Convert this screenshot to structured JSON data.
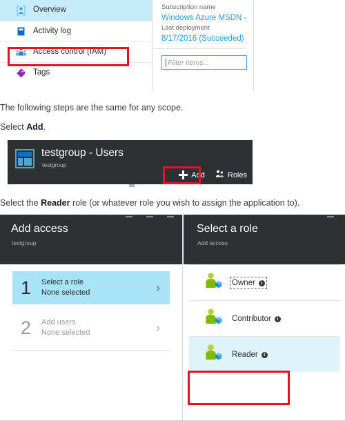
{
  "resource_nav": {
    "items": [
      {
        "label": "Overview",
        "icon": "overview-icon",
        "selected": true
      },
      {
        "label": "Activity log",
        "icon": "activity-log-icon",
        "selected": false
      },
      {
        "label": "Access control (IAM)",
        "icon": "access-control-icon",
        "selected": false
      },
      {
        "label": "Tags",
        "icon": "tag-icon",
        "selected": false
      }
    ]
  },
  "properties": {
    "subscription_label": "Subscription name",
    "subscription_value": "Windows Azure MSDN -",
    "deployment_label": "Last deployment",
    "deployment_value": "8/17/2016 (Succeeded)",
    "filter_placeholder": "Filter items..."
  },
  "prose": {
    "line1": "The following steps are the same for any scope.",
    "line2_prefix": "Select ",
    "line2_bold": "Add",
    "line2_suffix": ".",
    "line3_prefix": "Select the ",
    "line3_bold": "Reader",
    "line3_suffix": " role (or whatever role you wish to assign the application to)."
  },
  "users_blade": {
    "title": "testgroup - Users",
    "subtitle": "testgroup",
    "icon": "resource-group-icon",
    "commands": [
      {
        "label": "Add",
        "icon": "plus-icon",
        "highlighted": true
      },
      {
        "label": "Roles",
        "icon": "roles-icon",
        "highlighted": false
      }
    ]
  },
  "add_access_blade": {
    "title": "Add access",
    "subtitle": "testgroup",
    "steps": [
      {
        "number": "1",
        "title": "Select a role",
        "value": "None selected",
        "state": "active"
      },
      {
        "number": "2",
        "title": "Add users",
        "value": "None selected",
        "state": "disabled"
      }
    ]
  },
  "select_role_blade": {
    "title": "Select a role",
    "subtitle": "Add access",
    "roles": [
      {
        "name": "Owner",
        "icon": "role-user-icon",
        "info": "i",
        "selected": false,
        "focused": true
      },
      {
        "name": "Contributor",
        "icon": "role-user-icon",
        "info": "i",
        "selected": false,
        "focused": false
      },
      {
        "name": "Reader",
        "icon": "role-user-icon",
        "info": "i",
        "selected": true,
        "focused": false
      }
    ]
  },
  "annotations": {
    "highlight_color": "#e81123",
    "boxes": [
      {
        "target": "Access control (IAM)"
      },
      {
        "target": "Add"
      },
      {
        "target": "Reader"
      }
    ]
  },
  "colors": {
    "blade_dark": "#2d3134",
    "selection_blue": "#c6ebfa",
    "step_active_blue": "#a8e4f7",
    "role_selected_blue": "#dff3fb",
    "link_blue": "#2a9fd8",
    "accent_red": "#e81123"
  }
}
